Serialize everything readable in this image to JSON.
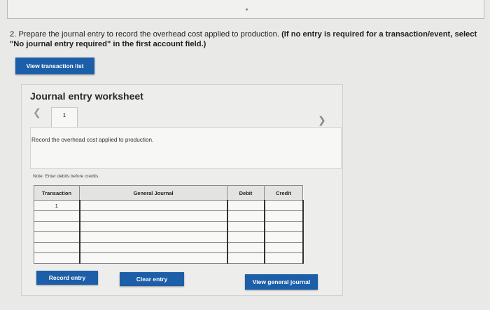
{
  "question": {
    "main": "2. Prepare the journal entry to record the overhead cost applied to production.",
    "instruction": "(If no entry is required for a transaction/event, select \"No journal entry required\" in the first account field.)"
  },
  "buttons": {
    "view_transactions": "View transaction list",
    "record_entry": "Record entry",
    "clear_entry": "Clear entry",
    "view_general_journal": "View general journal"
  },
  "worksheet": {
    "title": "Journal entry worksheet",
    "tab_label": "1",
    "instruction": "Record the overhead cost applied to production.",
    "note": "Note: Enter debits before credits."
  },
  "journal_table": {
    "headers": [
      "Transaction",
      "General Journal",
      "Debit",
      "Credit"
    ],
    "rows": [
      {
        "transaction": "1",
        "account": "",
        "debit": "",
        "credit": ""
      },
      {
        "transaction": "",
        "account": "",
        "debit": "",
        "credit": ""
      },
      {
        "transaction": "",
        "account": "",
        "debit": "",
        "credit": ""
      },
      {
        "transaction": "",
        "account": "",
        "debit": "",
        "credit": ""
      },
      {
        "transaction": "",
        "account": "",
        "debit": "",
        "credit": ""
      },
      {
        "transaction": "",
        "account": "",
        "debit": "",
        "credit": ""
      }
    ]
  },
  "icons": {
    "prev": "chevron-left-icon",
    "next": "chevron-right-icon"
  }
}
